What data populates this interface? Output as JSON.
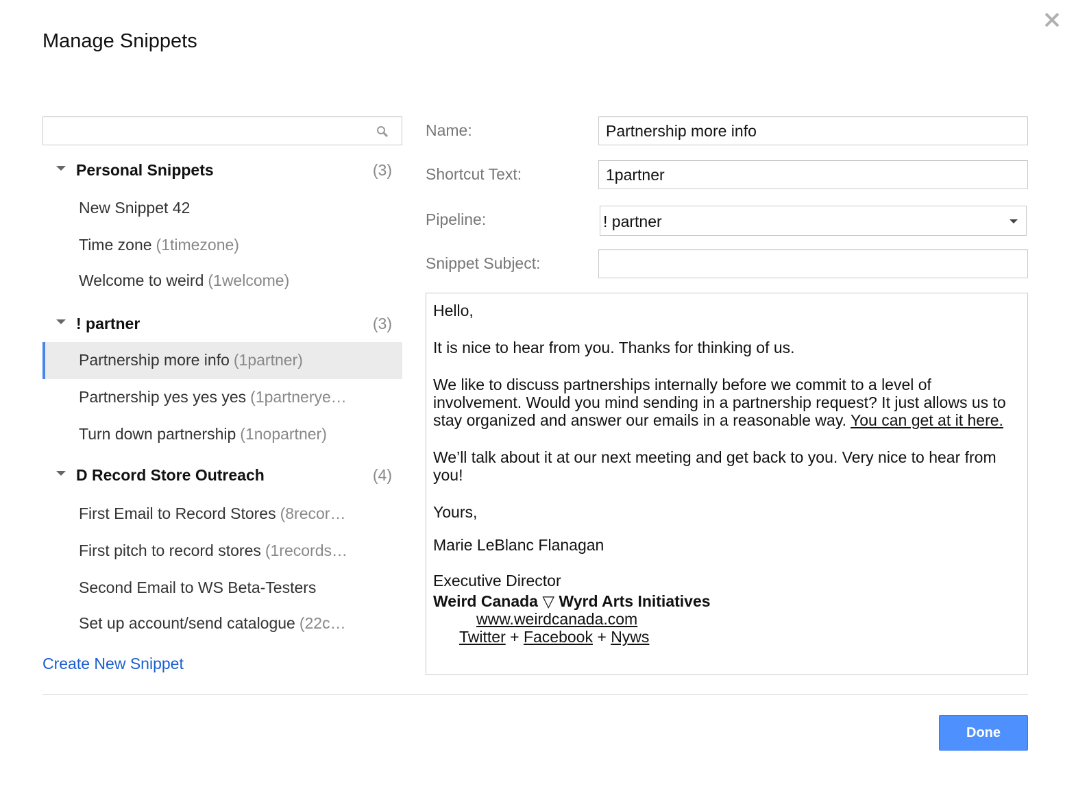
{
  "dialog": {
    "title": "Manage Snippets"
  },
  "search": {
    "placeholder": "",
    "value": ""
  },
  "groups": [
    {
      "name": "Personal Snippets",
      "count": "(3)"
    },
    {
      "name": "! partner",
      "count": "(3)"
    },
    {
      "name": "D Record Store Outreach",
      "count": "(4)"
    }
  ],
  "snippets": [
    {
      "name": "New Snippet 42",
      "shortcut": ""
    },
    {
      "name": "Time zone",
      "shortcut": "(1timezone)"
    },
    {
      "name": "Welcome to weird",
      "shortcut": "(1welcome)"
    },
    {
      "name": "Partnership more info",
      "shortcut": "(1partner)"
    },
    {
      "name": "Partnership yes yes yes",
      "shortcut": "(1partnerye…"
    },
    {
      "name": "Turn down partnership",
      "shortcut": "(1nopartner)"
    },
    {
      "name": "First Email to Record Stores",
      "shortcut": "(8recor…"
    },
    {
      "name": "First pitch to record stores",
      "shortcut": "(1records…"
    },
    {
      "name": "Second Email to WS Beta-Testers",
      "shortcut": ""
    },
    {
      "name": "Set up account/send catalogue",
      "shortcut": "(22c…"
    }
  ],
  "selected_snippet": "Partnership more info",
  "create_link": "Create New Snippet",
  "form": {
    "name_label": "Name:",
    "name_value": "Partnership more info",
    "shortcut_label": "Shortcut Text:",
    "shortcut_value": "1partner",
    "pipeline_label": "Pipeline:",
    "pipeline_value": "! partner",
    "subject_label": "Snippet Subject:",
    "subject_value": ""
  },
  "body": {
    "greeting": "Hello,",
    "p1": "It is nice to hear from you. Thanks for thinking of us.",
    "p2": "We like to discuss partnerships internally before we commit to a level of involvement. Would you mind sending in a partnership request? It just allows us to stay organized and answer our emails in a reasonable way.",
    "p2_link": "You can get at it here.",
    "p3": "We’ll talk about it at our next meeting and get back to you. Very nice to hear from you!",
    "closing": "Yours,",
    "signature_name": "Marie LeBlanc Flanagan",
    "signature_title": "Executive Director",
    "signature_org": "Weird Canada ▽ Wyrd Arts Initiatives",
    "website": "www.weirdcanada.com",
    "link_twitter": "Twitter",
    "plus1": "+",
    "link_facebook": "Facebook",
    "plus2": "+",
    "link_nyws": "Nyws"
  },
  "done_label": "Done",
  "colors": {
    "accent": "#4d90fe",
    "link": "#1a5fd0",
    "selected_bar": "#4a86e8"
  },
  "icons": [
    "close-icon",
    "search-icon",
    "caret-down-icon"
  ]
}
